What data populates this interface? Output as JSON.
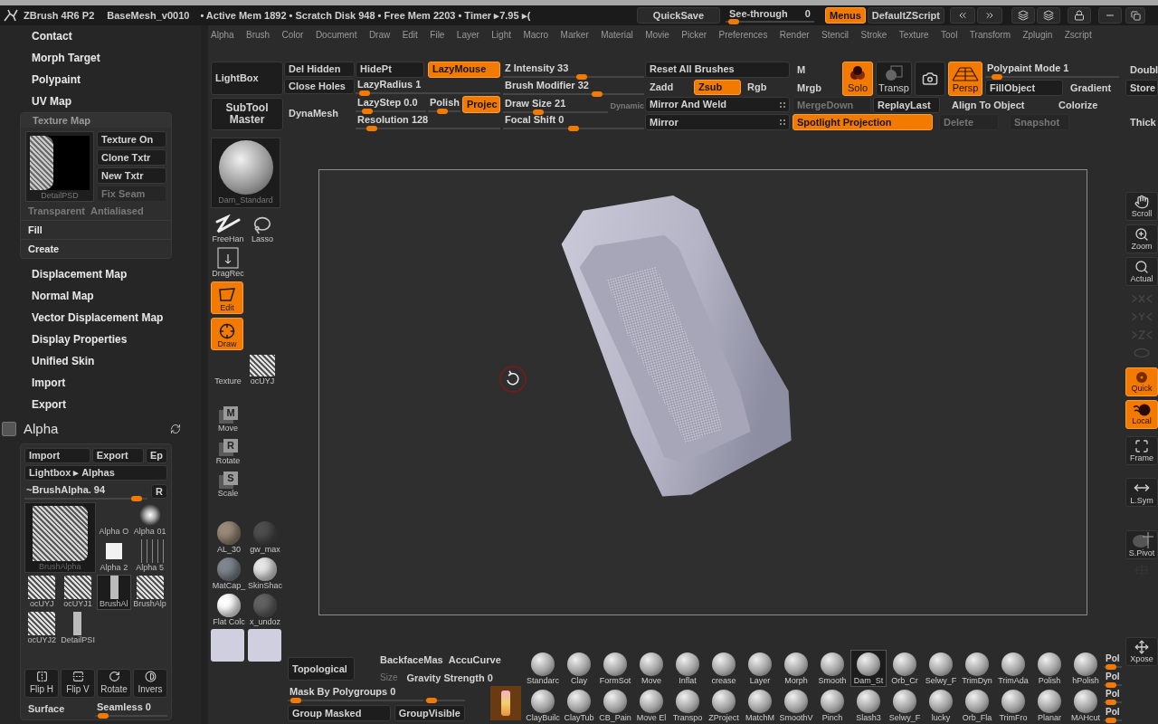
{
  "title_bar": {
    "app": "ZBrush 4R6 P2",
    "file": "BaseMesh_v0010",
    "stats": "• Active Mem 1892 • Scratch Disk 948 • Free Mem 2203 • Timer ▸7.95 ▸(",
    "quicksave": "QuickSave",
    "see_through": {
      "label": "See-through",
      "value": "0",
      "level": 0.03
    },
    "menus": {
      "label": "Menus",
      "on": true
    },
    "script": "DefaultZScript"
  },
  "menu_bar": [
    "Alpha",
    "Brush",
    "Color",
    "Document",
    "Draw",
    "Edit",
    "File",
    "Layer",
    "Light",
    "Macro",
    "Marker",
    "Material",
    "Movie",
    "Picker",
    "Preferences",
    "Render",
    "Stencil",
    "Stroke",
    "Texture",
    "Tool",
    "Transform",
    "Zplugin",
    "Zscript"
  ],
  "left_panel": {
    "items_top": [
      "Contact",
      "Morph Target",
      "Polypaint",
      "UV Map"
    ],
    "texture_map": {
      "title": "Texture Map",
      "thumbnail": "DetailPSD",
      "buttons": [
        {
          "label": "Texture On",
          "disabled": false
        },
        {
          "label": "Clone Txtr",
          "disabled": false
        },
        {
          "label": "New Txtr",
          "disabled": false
        },
        {
          "label": "Fix Seam",
          "disabled": true
        }
      ],
      "options": [
        {
          "label": "Transparent",
          "disabled": true
        },
        {
          "label": "Antialiased",
          "disabled": true
        }
      ],
      "actions": [
        "Fill",
        "Create"
      ]
    },
    "items_bottom": [
      "Displacement Map",
      "Normal Map",
      "Vector Displacement Map",
      "Display Properties",
      "Unified Skin",
      "Import",
      "Export"
    ]
  },
  "alpha": {
    "title": "Alpha",
    "import": "Import",
    "export": "Export",
    "ep": "Ep",
    "lightbox": "Lightbox ▸ Alphas",
    "brush_alpha": {
      "label": "~BrushAlpha. 94",
      "level": 0.95
    },
    "r": "R",
    "current": "BrushAlpha",
    "items": [
      {
        "label": "Alpha O",
        "kind": "blank",
        "selected": false
      },
      {
        "label": "Alpha 01",
        "kind": "soft_dot",
        "selected": false
      },
      {
        "label": "Alpha 2",
        "kind": "square",
        "selected": false
      },
      {
        "label": "Alpha 5",
        "kind": "lines",
        "selected": false
      },
      {
        "label": "ocUYJ",
        "kind": "mesh",
        "selected": false
      },
      {
        "label": "ocUYJ1",
        "kind": "mesh",
        "selected": false
      },
      {
        "label": "BrushAl",
        "kind": "strip",
        "selected": true
      },
      {
        "label": "BrushAlp",
        "kind": "mesh",
        "selected": false
      },
      {
        "label": "ocUYJ2",
        "kind": "mesh",
        "selected": false
      },
      {
        "label": "DetailPSI",
        "kind": "strip",
        "selected": false
      }
    ],
    "tools": [
      {
        "label": "Flip H",
        "kind": "fliph"
      },
      {
        "label": "Flip V",
        "kind": "flipv"
      },
      {
        "label": "Rotate",
        "kind": "rotate"
      },
      {
        "label": "Invers",
        "kind": "invert"
      }
    ],
    "surface": "Surface",
    "seamless": {
      "label": "Seamless 0",
      "level": 0.05
    }
  },
  "toolbar": {
    "lightbox": "LightBox",
    "subtool_master": "SubTool Master",
    "del_hidden": "Del Hidden",
    "close_holes": "Close Holes",
    "dynamesh": "DynaMesh",
    "hidept": "HidePt",
    "lazymouse": {
      "label": "LazyMouse",
      "on": true
    },
    "lazyradius": {
      "label": "LazyRadius 1",
      "level": 0.03
    },
    "lazystep": {
      "label": "LazyStep 0.0",
      "level": 0.1
    },
    "polish": {
      "label": "Polish",
      "level": 0.4
    },
    "projection": {
      "label": "Projec",
      "on": true
    },
    "resolution": {
      "label": "Resolution 128",
      "level": 0.08
    },
    "z_intensity": {
      "label": "Z Intensity 33",
      "level": 0.56
    },
    "brush_modifier": {
      "label": "Brush Modifier 32",
      "level": 0.68
    },
    "draw_size": {
      "label": "Draw Size 21",
      "level": 0.32
    },
    "dynamic": {
      "label": "Dynamic",
      "on": false
    },
    "focal_shift": {
      "label": "Focal Shift 0",
      "level": 0.5
    },
    "reset_all": "Reset All Brushes",
    "zadd": {
      "label": "Zadd",
      "on": false
    },
    "zsub": {
      "label": "Zsub",
      "on": true
    },
    "rgb": {
      "label": "Rgb",
      "on": false
    },
    "mirror_weld": "Mirror And Weld",
    "mirror": "Mirror",
    "m": {
      "label": "M",
      "on": false
    },
    "mrgb": {
      "label": "Mrgb",
      "on": false
    },
    "merge_down": {
      "label": "MergeDown",
      "disabled": true
    },
    "spotlight": {
      "label": "Spotlight Projection",
      "on": true
    },
    "solo": {
      "label": "Solo",
      "on": true
    },
    "transp": {
      "label": "Transp",
      "on": false
    },
    "persp": {
      "label": "Persp",
      "on": true
    },
    "replay_last": "ReplayLast",
    "polypaint_mode": {
      "label": "Polypaint Mode 1",
      "level": 0.05
    },
    "fill_object": "FillObject",
    "gradient": "Gradient",
    "align_to_object": "Align To Object",
    "colorize": "Colorize",
    "delete": {
      "label": "Delete",
      "disabled": true
    },
    "snapshot": {
      "label": "Snapshot",
      "disabled": true
    },
    "double": "Doubl",
    "store": "Store",
    "thick": "Thick"
  },
  "left_shelf": {
    "current_brush": "Dam_Standard",
    "stroke": "FreeHan",
    "selection": "Lasso",
    "drag": "DragRec",
    "edit": {
      "label": "Edit",
      "on": true
    },
    "draw": {
      "label": "Draw",
      "on": true
    },
    "texture": "Texture",
    "texture_thumb": "ocUYJ",
    "transforms": [
      {
        "letter": "M",
        "label": "Move"
      },
      {
        "letter": "R",
        "label": "Rotate"
      },
      {
        "letter": "S",
        "label": "Scale"
      }
    ],
    "materials": [
      {
        "label": "AL_30",
        "color": "#9b8a79"
      },
      {
        "label": "gw_max",
        "color": "#4e4e4e"
      },
      {
        "label": "MatCap_",
        "color": "#7f878e"
      },
      {
        "label": "SkinShac",
        "color": "#e6e6e6"
      },
      {
        "label": "Flat Colc",
        "color": "#ffffff"
      },
      {
        "label": "x_undoz",
        "color": "#626262"
      }
    ],
    "colors": [
      {
        "color": "#cfcfe0"
      },
      {
        "color": "#cfcfe0"
      }
    ]
  },
  "right_shelf": [
    {
      "kind": "scroll",
      "label": "Scroll",
      "on": false,
      "disabled": false
    },
    {
      "kind": "zoom",
      "label": "Zoom",
      "on": false,
      "disabled": false
    },
    {
      "kind": "actual",
      "label": "Actual",
      "on": false,
      "disabled": false
    },
    {
      "kind": "xaxis",
      "on": false,
      "disabled": true
    },
    {
      "kind": "yaxis",
      "on": false,
      "disabled": true
    },
    {
      "kind": "zaxis",
      "on": false,
      "disabled": true
    },
    {
      "kind": "ring",
      "on": false,
      "disabled": true
    },
    {
      "kind": "quick",
      "label": "Quick",
      "on": true,
      "disabled": false
    },
    {
      "kind": "local",
      "label": "Local",
      "on": true,
      "disabled": false
    },
    {
      "kind": "frame",
      "label": "Frame",
      "on": false,
      "disabled": false
    },
    {
      "kind": "lsym",
      "label": "L.Sym",
      "on": false,
      "disabled": false
    },
    {
      "kind": "spivot",
      "label": "S.Pivot",
      "on": false,
      "disabled": false
    },
    {
      "kind": "grp",
      "on": false,
      "disabled": true
    },
    {
      "kind": "xpose",
      "label": "Xpose",
      "on": false,
      "disabled": false
    }
  ],
  "bottom": {
    "topological": "Topological",
    "backface": "BackfaceMas",
    "accucurve": "AccuCurve",
    "size": {
      "label": "Size",
      "disabled": true
    },
    "gravity": "Gravity Strength 0",
    "mask_polygroups": {
      "label": "Mask By Polygroups 0",
      "level": 0.02
    },
    "slider_2": {
      "level": 0.04
    },
    "group_masked": "Group Masked",
    "group_visible": "GroupVisible",
    "brushes": [
      [
        {
          "label": "Standarc",
          "selected": false
        },
        {
          "label": "Clay",
          "selected": false
        },
        {
          "label": "FormSot",
          "selected": false
        },
        {
          "label": "Move",
          "selected": false
        },
        {
          "label": "Inflat",
          "selected": false
        },
        {
          "label": "crease",
          "selected": false
        },
        {
          "label": "Layer",
          "selected": false
        },
        {
          "label": "Morph",
          "selected": false
        },
        {
          "label": "Smooth",
          "selected": false
        },
        {
          "label": "Dam_St",
          "selected": true
        },
        {
          "label": "Orb_Cr",
          "selected": false
        },
        {
          "label": "Selwy_F",
          "selected": false
        },
        {
          "label": "TrimDyn",
          "selected": false
        },
        {
          "label": "TrimAda",
          "selected": false
        },
        {
          "label": "Polish",
          "selected": false
        },
        {
          "label": "hPolish",
          "selected": false
        }
      ],
      [
        {
          "label": "ClayBuilc",
          "selected": false
        },
        {
          "label": "ClayTub",
          "selected": false
        },
        {
          "label": "CB_Pain",
          "selected": false
        },
        {
          "label": "Move El",
          "selected": false
        },
        {
          "label": "Transpo",
          "selected": false
        },
        {
          "label": "ZProject",
          "selected": false
        },
        {
          "label": "MatchM",
          "selected": false
        },
        {
          "label": "SmoothV",
          "selected": false
        },
        {
          "label": "Pinch",
          "selected": false
        },
        {
          "label": "Slash3",
          "selected": false
        },
        {
          "label": "Selwy_F",
          "selected": false
        },
        {
          "label": "lucky",
          "selected": false
        },
        {
          "label": "Orb_Fla",
          "selected": false
        },
        {
          "label": "TrimFro",
          "selected": false
        },
        {
          "label": "Planar",
          "selected": false
        },
        {
          "label": "MAHcut",
          "selected": false
        }
      ]
    ],
    "pol_sliders": [
      {
        "label": "Pol",
        "level": 0.3
      },
      {
        "label": "Pol",
        "level": 0.3
      },
      {
        "label": "Pol",
        "level": 0.3
      },
      {
        "label": "Pol",
        "level": 0.3
      }
    ]
  }
}
